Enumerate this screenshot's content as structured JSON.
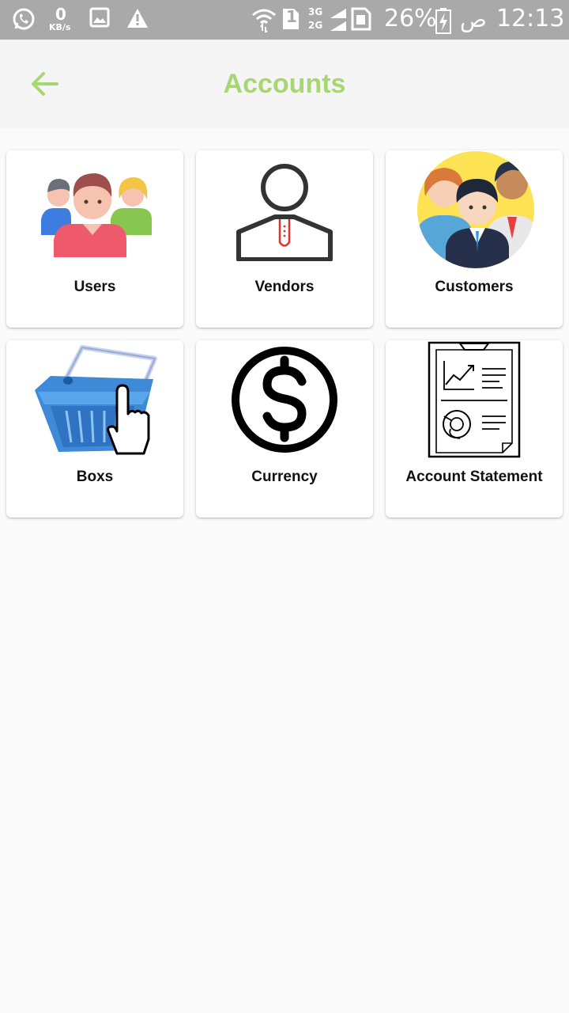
{
  "status_bar": {
    "network_speed_value": "0",
    "network_speed_unit": "KB/s",
    "sim_slot": "1",
    "net_top": "3G",
    "net_bottom": "2G",
    "battery": "26%",
    "ampm": "ص",
    "time": "12:13"
  },
  "app_bar": {
    "title": "Accounts",
    "accent_color": "#a8d672"
  },
  "cards": [
    {
      "label": "Users",
      "icon": "users-group-icon"
    },
    {
      "label": "Vendors",
      "icon": "vendor-person-icon"
    },
    {
      "label": "Customers",
      "icon": "customers-group-icon"
    },
    {
      "label": "Boxs",
      "icon": "shopping-basket-hand-icon"
    },
    {
      "label": "Currency",
      "icon": "dollar-coin-icon"
    },
    {
      "label": "Account Statement",
      "icon": "report-document-icon"
    }
  ]
}
